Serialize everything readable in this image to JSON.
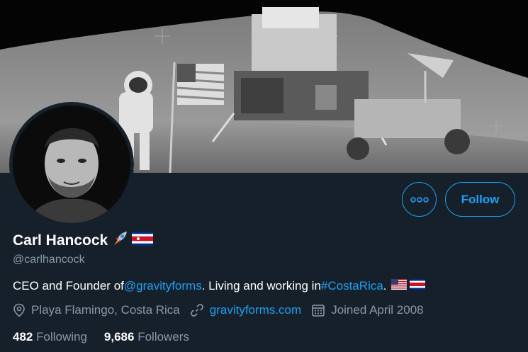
{
  "profile": {
    "display_name": "Carl Hancock",
    "handle": "@carlhancock",
    "bio": {
      "prefix": "CEO and Founder of ",
      "mention": "@gravityforms",
      "middle": ". Living and working in ",
      "hashtag": "#CostaRica",
      "suffix": "."
    },
    "location": "Playa Flamingo, Costa Rica",
    "website": "gravityforms.com",
    "joined": "Joined April 2008"
  },
  "stats": {
    "following_count": "482",
    "following_label": "Following",
    "followers_count": "9,686",
    "followers_label": "Followers"
  },
  "actions": {
    "follow_label": "Follow",
    "more_icon": "more-horizontal-icon"
  },
  "colors": {
    "background": "#15202b",
    "accent": "#1da1f2",
    "secondary_text": "#8899a6"
  }
}
